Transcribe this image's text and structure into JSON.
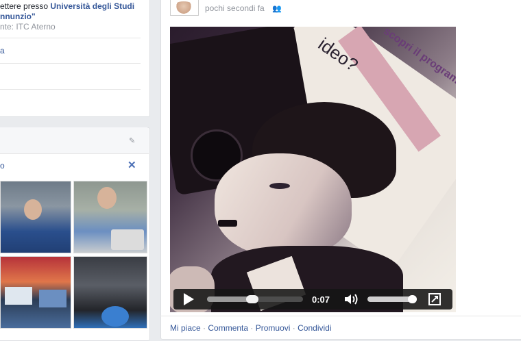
{
  "education": {
    "line1_prefix": "ettere presso",
    "line1_school": "Università degli Studi",
    "line2": "nnunzio\"",
    "line3": "nte: ITC Aterno",
    "row_a": "a"
  },
  "photos": {
    "title": "o",
    "pin_icon": "pin-icon",
    "close_icon": "close-icon"
  },
  "post": {
    "timestamp": "pochi secondi fa",
    "audience_icon": "friends-icon",
    "video_overlay_text1": "ideo?",
    "video_overlay_text2": "scopri il programma",
    "player": {
      "time": "0:07",
      "progress": 0.47,
      "volume": 0.9
    },
    "actions": {
      "like": "Mi piace",
      "comment": "Commenta",
      "promote": "Promuovi",
      "share": "Condividi",
      "separator": "·"
    }
  }
}
